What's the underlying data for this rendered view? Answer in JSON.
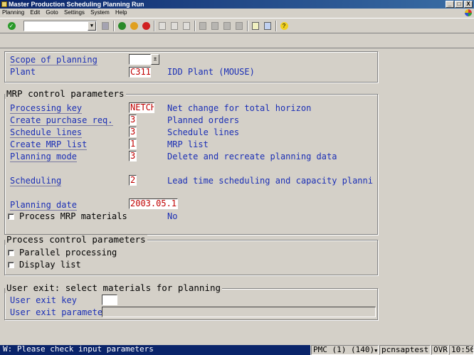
{
  "window": {
    "title": "Master Production Scheduling Planning Run",
    "buttons": [
      "_",
      "□",
      "X"
    ]
  },
  "menu": [
    "Planning",
    "Edit",
    "Goto",
    "Settings",
    "System",
    "Help"
  ],
  "toolbar": {
    "command_value": "",
    "icons": [
      "enter-icon",
      "save-icon",
      "back-icon",
      "exit-icon",
      "cancel-icon",
      "print-icon",
      "find-icon",
      "find-next-icon",
      "first-page-icon",
      "previous-page-icon",
      "next-page-icon",
      "last-page-icon",
      "create-session-icon",
      "shortcut-icon",
      "help-icon"
    ]
  },
  "header": {
    "scope_label": "Scope of planning",
    "scope_value": "",
    "plant_label": "Plant",
    "plant_value": "C311",
    "plant_desc": "IDD Plant (MOUSE)"
  },
  "mrp": {
    "title": "MRP control parameters",
    "processing_key_label": "Processing key",
    "processing_key_value": "NETCH",
    "processing_key_desc": "Net change for total horizon",
    "create_pr_label": "Create purchase req.",
    "create_pr_value": "3",
    "create_pr_desc": "Planned orders",
    "schedule_lines_label": "Schedule lines",
    "schedule_lines_value": "3",
    "schedule_lines_desc": "Schedule lines",
    "create_mrp_list_label": "Create MRP list",
    "create_mrp_list_value": "1",
    "create_mrp_list_desc": "MRP list",
    "planning_mode_label": "Planning mode",
    "planning_mode_value": "3",
    "planning_mode_desc": "Delete and recreate planning data",
    "scheduling_label": "Scheduling",
    "scheduling_value": "2",
    "scheduling_desc": "Lead time scheduling and capacity planni",
    "planning_date_label": "Planning date",
    "planning_date_value": "2003.05.15",
    "process_mrp_label": "Process MRP materials",
    "process_mrp_desc": "No"
  },
  "process_control": {
    "title": "Process control parameters",
    "parallel_label": "Parallel processing",
    "display_list_label": "Display list"
  },
  "user_exit": {
    "title": "User exit: select materials for planning",
    "key_label": "User exit key",
    "key_value": "",
    "param_label": "User exit parameter",
    "param_value": ""
  },
  "status": {
    "message": "W: Please check input parameters",
    "system": "PMC (1) (140)",
    "server": "pcnsaptest",
    "mode": "OVR",
    "time": "10:56"
  }
}
